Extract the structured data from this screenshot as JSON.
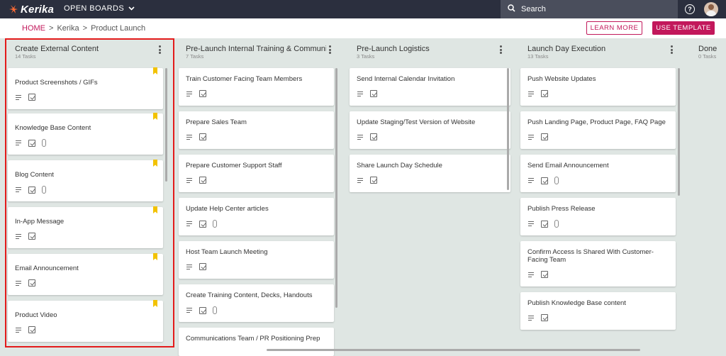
{
  "topbar": {
    "logo_text": "Kerika",
    "boards_label": "OPEN BOARDS",
    "search_label": "Search",
    "help_label": "?"
  },
  "breadcrumb": {
    "home": "HOME",
    "sep1": ">",
    "middle": "Kerika",
    "sep2": ">",
    "current": "Product Launch"
  },
  "actions": {
    "learn_more": "LEARN MORE",
    "use_template": "USE TEMPLATE"
  },
  "columns": [
    {
      "title": "Create External Content",
      "count": "14 Tasks",
      "cards": [
        {
          "title": "Product Screenshots / GIFs",
          "attach": false,
          "flag": true
        },
        {
          "title": "Knowledge Base Content",
          "attach": true,
          "flag": true
        },
        {
          "title": "Blog Content",
          "attach": true,
          "flag": true
        },
        {
          "title": "In-App Message",
          "attach": false,
          "flag": true
        },
        {
          "title": "Email Announcement",
          "attach": false,
          "flag": true
        },
        {
          "title": "Product Video",
          "attach": false,
          "flag": true
        }
      ]
    },
    {
      "title": "Pre-Launch Internal Training & Communi…",
      "count": "7 Tasks",
      "cards": [
        {
          "title": "Train Customer Facing Team Members",
          "attach": false
        },
        {
          "title": "Prepare Sales Team",
          "attach": false
        },
        {
          "title": "Prepare Customer Support Staff",
          "attach": false
        },
        {
          "title": "Update Help Center articles",
          "attach": true
        },
        {
          "title": "Host Team Launch Meeting",
          "attach": false
        },
        {
          "title": "Create Training Content, Decks, Handouts",
          "attach": true
        },
        {
          "title": "Communications Team / PR Positioning Prep",
          "attach": false
        }
      ]
    },
    {
      "title": "Pre-Launch Logistics",
      "count": "3 Tasks",
      "cards": [
        {
          "title": "Send Internal Calendar Invitation",
          "attach": false
        },
        {
          "title": "Update Staging/Test Version of Website",
          "attach": false
        },
        {
          "title": "Share Launch Day Schedule",
          "attach": false
        }
      ]
    },
    {
      "title": "Launch Day Execution",
      "count": "13 Tasks",
      "cards": [
        {
          "title": "Push Website Updates",
          "attach": false
        },
        {
          "title": "Push Landing Page, Product Page, FAQ Page",
          "attach": false
        },
        {
          "title": "Send Email Announcement",
          "attach": true
        },
        {
          "title": "Publish Press Release",
          "attach": true
        },
        {
          "title": "Confirm Access Is Shared With Customer-Facing Team",
          "attach": false
        },
        {
          "title": "Publish Knowledge Base content",
          "attach": false
        }
      ]
    },
    {
      "title": "Done",
      "count": "0 Tasks",
      "cards": []
    }
  ],
  "colors": {
    "topbar": "#2b2f3e",
    "accent": "#c2185b",
    "board_bg": "#dfe6e3",
    "flag": "#f2c200",
    "highlight": "#e31b1b"
  }
}
